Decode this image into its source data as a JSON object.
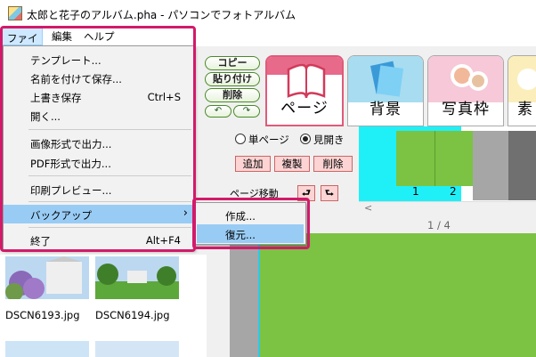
{
  "window": {
    "title": "太郎と花子のアルバム.pha - パソコンでフォトアルバム"
  },
  "menubar": {
    "file": "ファイル",
    "edit": "編集",
    "help": "ヘルプ"
  },
  "file_menu": {
    "items": [
      {
        "label": "テンプレート..."
      },
      {
        "label": "名前を付けて保存..."
      },
      {
        "label": "上書き保存",
        "shortcut": "Ctrl+S"
      },
      {
        "label": "開く..."
      },
      {
        "label": "画像形式で出力..."
      },
      {
        "label": "PDF形式で出力..."
      },
      {
        "label": "印刷プレビュー..."
      },
      {
        "label": "バックアップ",
        "submenu_arrow": "›"
      },
      {
        "label": "終了",
        "shortcut": "Alt+F4"
      }
    ]
  },
  "backup_submenu": {
    "items": [
      {
        "label": "作成..."
      },
      {
        "label": "復元..."
      }
    ],
    "highlighted": "復元..."
  },
  "edit_buttons": {
    "copy": "コピー",
    "paste": "貼り付け",
    "delete": "削除",
    "undo": "↶",
    "redo": "↷"
  },
  "tabs": [
    {
      "label": "ページ",
      "active": true
    },
    {
      "label": "背景"
    },
    {
      "label": "写真枠"
    },
    {
      "label": "素"
    }
  ],
  "page_view": {
    "single": "単ページ",
    "spread": "見開き",
    "selected": "spread"
  },
  "page_buttons": {
    "add": "追加",
    "duplicate": "複製",
    "delete": "削除"
  },
  "page_move": {
    "label": "ページ移動"
  },
  "page_strip": {
    "pages": [
      "1",
      "2"
    ],
    "scroll_left": "<"
  },
  "page_counter": "1 / 4",
  "thumbnails": [
    {
      "filename": "DSCN6193.jpg"
    },
    {
      "filename": "DSCN6194.jpg"
    }
  ],
  "colors": {
    "highlight": "#d21a6a",
    "menu_selected": "#99ccf5",
    "canvas": "#7cc243",
    "strip_selection": "#1ff0f8"
  }
}
